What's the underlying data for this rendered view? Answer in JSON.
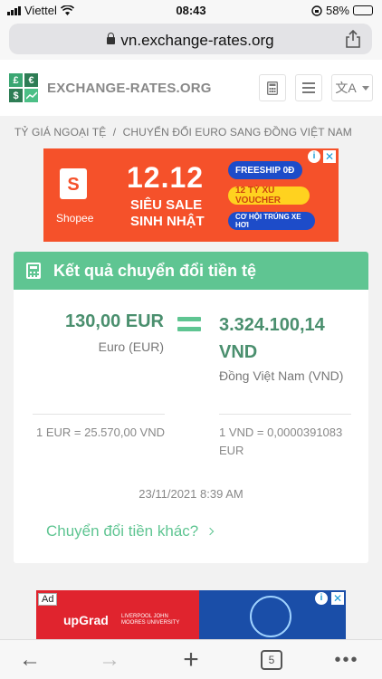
{
  "status_bar": {
    "carrier": "Viettel",
    "time": "08:43",
    "battery": "58%",
    "battery_level": 0.58
  },
  "browser": {
    "url": "vn.exchange-rates.org"
  },
  "site": {
    "logo": {
      "tl": "£",
      "tr": "€",
      "bl": "$",
      "br": ""
    },
    "brand": "EXCHANGE-RATES.ORG",
    "lang_label": "文A"
  },
  "breadcrumb": {
    "item1": "TỶ GIÁ NGOẠI TỆ",
    "separator": "/",
    "item2": "CHUYỂN ĐỔI EURO SANG ĐỒNG VIỆT NAM"
  },
  "ad_top": {
    "brand": "Shopee",
    "logo_letter": "S",
    "headline": "12.12",
    "line1": "SIÊU SALE",
    "line2": "SINH NHẬT",
    "pill1": "FREESHIP 0Đ",
    "pill2": "12 TỶ XU VOUCHER",
    "pill3": "CƠ HỘI TRÚNG XE HƠI",
    "info": "i",
    "close": "✕"
  },
  "result": {
    "title": "Kết quả chuyển đổi tiền tệ",
    "from_amount": "130,00 EUR",
    "from_name": "Euro (EUR)",
    "to_amount": "3.324.100,14 VND",
    "to_name": "Đồng Việt Nam (VND)",
    "rate_from": "1 EUR = 25.570,00 VND",
    "rate_to": "1 VND = 0,0000391083 EUR",
    "timestamp": "23/11/2021 8:39 AM",
    "other_link": "Chuyển đổi tiền khác?"
  },
  "ad_bottom": {
    "label": "Ad",
    "brand": "upGrad",
    "partner": "LIVERPOOL JOHN MOORES UNIVERSITY",
    "info": "i",
    "close": "✕"
  },
  "toolbar": {
    "back": "←",
    "forward": "→",
    "new_tab": "+",
    "tab_count": "5",
    "more": "•••"
  },
  "colors": {
    "accent": "#5fc592",
    "amount": "#4a8f6e",
    "ad_orange": "#f5512a"
  }
}
